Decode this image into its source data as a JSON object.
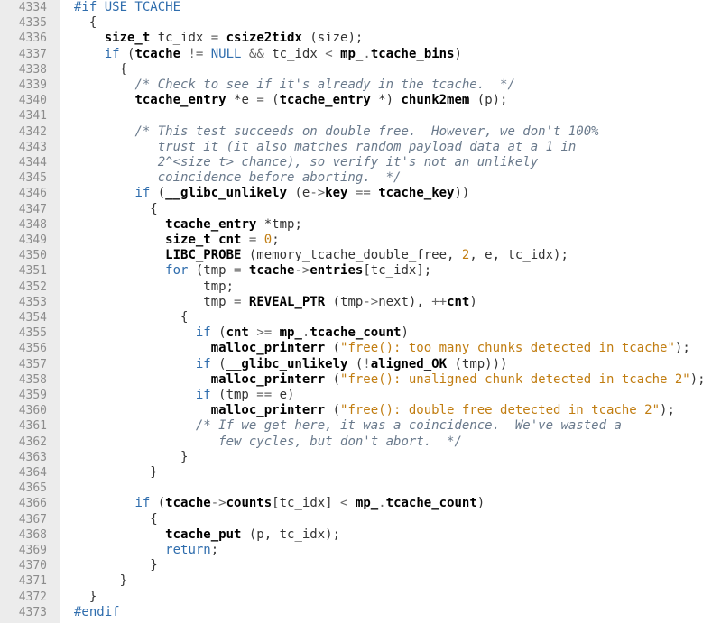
{
  "editor": {
    "lines": [
      {
        "n": "4334",
        "t": [
          [
            "pp",
            "#if USE_TCACHE"
          ]
        ]
      },
      {
        "n": "4335",
        "t": [
          [
            "br",
            "  {"
          ]
        ]
      },
      {
        "n": "4336",
        "t": [
          [
            "",
            "    "
          ],
          [
            "b",
            "size_t"
          ],
          [
            "",
            " tc_idx "
          ],
          [
            "op",
            "="
          ],
          [
            "",
            " "
          ],
          [
            "b",
            "csize2tidx"
          ],
          [
            "",
            " (size);"
          ]
        ]
      },
      {
        "n": "4337",
        "t": [
          [
            "",
            "    "
          ],
          [
            "kw",
            "if"
          ],
          [
            "",
            " ("
          ],
          [
            "b",
            "tcache"
          ],
          [
            "",
            " "
          ],
          [
            "op",
            "!="
          ],
          [
            "",
            " "
          ],
          [
            "kw",
            "NULL"
          ],
          [
            "",
            " "
          ],
          [
            "op",
            "&&"
          ],
          [
            "",
            " tc_idx "
          ],
          [
            "op",
            "<"
          ],
          [
            "",
            " "
          ],
          [
            "b",
            "mp_"
          ],
          [
            "op",
            "."
          ],
          [
            "b",
            "tcache_bins"
          ],
          [
            "",
            ")"
          ]
        ]
      },
      {
        "n": "4338",
        "t": [
          [
            "",
            "      {"
          ]
        ]
      },
      {
        "n": "4339",
        "t": [
          [
            "",
            "        "
          ],
          [
            "cm",
            "/* Check to see if it's already in the tcache.  */"
          ]
        ]
      },
      {
        "n": "4340",
        "t": [
          [
            "",
            "        "
          ],
          [
            "b",
            "tcache_entry"
          ],
          [
            "",
            " *e "
          ],
          [
            "op",
            "="
          ],
          [
            "",
            " ("
          ],
          [
            "b",
            "tcache_entry"
          ],
          [
            "",
            " *) "
          ],
          [
            "b",
            "chunk2mem"
          ],
          [
            "",
            " (p);"
          ]
        ]
      },
      {
        "n": "4341",
        "t": [
          [
            "",
            ""
          ]
        ]
      },
      {
        "n": "4342",
        "t": [
          [
            "",
            "        "
          ],
          [
            "cm",
            "/* This test succeeds on double free.  However, we don't 100%"
          ]
        ]
      },
      {
        "n": "4343",
        "t": [
          [
            "",
            "           "
          ],
          [
            "cm",
            "trust it (it also matches random payload data at a 1 in"
          ]
        ]
      },
      {
        "n": "4344",
        "t": [
          [
            "",
            "           "
          ],
          [
            "cm",
            "2^<size_t> chance), so verify it's not an unlikely"
          ]
        ]
      },
      {
        "n": "4345",
        "t": [
          [
            "",
            "           "
          ],
          [
            "cm",
            "coincidence before aborting.  */"
          ]
        ]
      },
      {
        "n": "4346",
        "t": [
          [
            "",
            "        "
          ],
          [
            "kw",
            "if"
          ],
          [
            "",
            " ("
          ],
          [
            "b",
            "__glibc_unlikely"
          ],
          [
            "",
            " (e"
          ],
          [
            "op",
            "->"
          ],
          [
            "b",
            "key"
          ],
          [
            "",
            " "
          ],
          [
            "op",
            "=="
          ],
          [
            "",
            " "
          ],
          [
            "b",
            "tcache_key"
          ],
          [
            "",
            "))"
          ]
        ]
      },
      {
        "n": "4347",
        "t": [
          [
            "",
            "          {"
          ]
        ]
      },
      {
        "n": "4348",
        "t": [
          [
            "",
            "            "
          ],
          [
            "b",
            "tcache_entry"
          ],
          [
            "",
            " *tmp;"
          ]
        ]
      },
      {
        "n": "4349",
        "t": [
          [
            "",
            "            "
          ],
          [
            "b",
            "size_t"
          ],
          [
            "",
            " "
          ],
          [
            "b",
            "cnt"
          ],
          [
            "",
            " "
          ],
          [
            "op",
            "="
          ],
          [
            "",
            " "
          ],
          [
            "num",
            "0"
          ],
          [
            "",
            ";"
          ]
        ]
      },
      {
        "n": "4350",
        "t": [
          [
            "",
            "            "
          ],
          [
            "b",
            "LIBC_PROBE"
          ],
          [
            "",
            " (memory_tcache_double_free, "
          ],
          [
            "num",
            "2"
          ],
          [
            "",
            ", e, tc_idx);"
          ]
        ]
      },
      {
        "n": "4351",
        "t": [
          [
            "",
            "            "
          ],
          [
            "kw",
            "for"
          ],
          [
            "",
            " (tmp "
          ],
          [
            "op",
            "="
          ],
          [
            "",
            " "
          ],
          [
            "b",
            "tcache"
          ],
          [
            "op",
            "->"
          ],
          [
            "b",
            "entries"
          ],
          [
            "",
            "[tc_idx];"
          ]
        ]
      },
      {
        "n": "4352",
        "t": [
          [
            "",
            "                 tmp;"
          ]
        ]
      },
      {
        "n": "4353",
        "t": [
          [
            "",
            "                 tmp "
          ],
          [
            "op",
            "="
          ],
          [
            "",
            " "
          ],
          [
            "b",
            "REVEAL_PTR"
          ],
          [
            "",
            " (tmp"
          ],
          [
            "op",
            "->"
          ],
          [
            "",
            "next), "
          ],
          [
            "op",
            "++"
          ],
          [
            "b",
            "cnt"
          ],
          [
            "",
            ")"
          ]
        ]
      },
      {
        "n": "4354",
        "t": [
          [
            "",
            "              {"
          ]
        ]
      },
      {
        "n": "4355",
        "t": [
          [
            "",
            "                "
          ],
          [
            "kw",
            "if"
          ],
          [
            "",
            " ("
          ],
          [
            "b",
            "cnt"
          ],
          [
            "",
            " "
          ],
          [
            "op",
            ">="
          ],
          [
            "",
            " "
          ],
          [
            "b",
            "mp_"
          ],
          [
            "op",
            "."
          ],
          [
            "b",
            "tcache_count"
          ],
          [
            "",
            ")"
          ]
        ]
      },
      {
        "n": "4356",
        "t": [
          [
            "",
            "                  "
          ],
          [
            "b",
            "malloc_printerr"
          ],
          [
            "",
            " ("
          ],
          [
            "str",
            "\"free(): too many chunks detected in tcache\""
          ],
          [
            "",
            ");"
          ]
        ]
      },
      {
        "n": "4357",
        "t": [
          [
            "",
            "                "
          ],
          [
            "kw",
            "if"
          ],
          [
            "",
            " ("
          ],
          [
            "b",
            "__glibc_unlikely"
          ],
          [
            "",
            " ("
          ],
          [
            "op",
            "!"
          ],
          [
            "b",
            "aligned_OK"
          ],
          [
            "",
            " (tmp)))"
          ]
        ]
      },
      {
        "n": "4358",
        "t": [
          [
            "",
            "                  "
          ],
          [
            "b",
            "malloc_printerr"
          ],
          [
            "",
            " ("
          ],
          [
            "str",
            "\"free(): unaligned chunk detected in tcache 2\""
          ],
          [
            "",
            ");"
          ]
        ]
      },
      {
        "n": "4359",
        "t": [
          [
            "",
            "                "
          ],
          [
            "kw",
            "if"
          ],
          [
            "",
            " (tmp "
          ],
          [
            "op",
            "=="
          ],
          [
            "",
            " e)"
          ]
        ]
      },
      {
        "n": "4360",
        "t": [
          [
            "",
            "                  "
          ],
          [
            "b",
            "malloc_printerr"
          ],
          [
            "",
            " ("
          ],
          [
            "str",
            "\"free(): double free detected in tcache 2\""
          ],
          [
            "",
            ");"
          ]
        ]
      },
      {
        "n": "4361",
        "t": [
          [
            "",
            "                "
          ],
          [
            "cm",
            "/* If we get here, it was a coincidence.  We've wasted a"
          ]
        ]
      },
      {
        "n": "4362",
        "t": [
          [
            "",
            "                   "
          ],
          [
            "cm",
            "few cycles, but don't abort.  */"
          ]
        ]
      },
      {
        "n": "4363",
        "t": [
          [
            "",
            "              }"
          ]
        ]
      },
      {
        "n": "4364",
        "t": [
          [
            "",
            "          }"
          ]
        ]
      },
      {
        "n": "4365",
        "t": [
          [
            "",
            ""
          ]
        ]
      },
      {
        "n": "4366",
        "t": [
          [
            "",
            "        "
          ],
          [
            "kw",
            "if"
          ],
          [
            "",
            " ("
          ],
          [
            "b",
            "tcache"
          ],
          [
            "op",
            "->"
          ],
          [
            "b",
            "counts"
          ],
          [
            "",
            "[tc_idx] "
          ],
          [
            "op",
            "<"
          ],
          [
            "",
            " "
          ],
          [
            "b",
            "mp_"
          ],
          [
            "op",
            "."
          ],
          [
            "b",
            "tcache_count"
          ],
          [
            "",
            ")"
          ]
        ]
      },
      {
        "n": "4367",
        "t": [
          [
            "",
            "          {"
          ]
        ]
      },
      {
        "n": "4368",
        "t": [
          [
            "",
            "            "
          ],
          [
            "b",
            "tcache_put"
          ],
          [
            "",
            " (p, tc_idx);"
          ]
        ]
      },
      {
        "n": "4369",
        "t": [
          [
            "",
            "            "
          ],
          [
            "kw",
            "return"
          ],
          [
            "",
            ";"
          ]
        ]
      },
      {
        "n": "4370",
        "t": [
          [
            "",
            "          }"
          ]
        ]
      },
      {
        "n": "4371",
        "t": [
          [
            "",
            "      }"
          ]
        ]
      },
      {
        "n": "4372",
        "t": [
          [
            "",
            "  }"
          ]
        ]
      },
      {
        "n": "4373",
        "t": [
          [
            "pp",
            "#endif"
          ]
        ]
      }
    ]
  }
}
